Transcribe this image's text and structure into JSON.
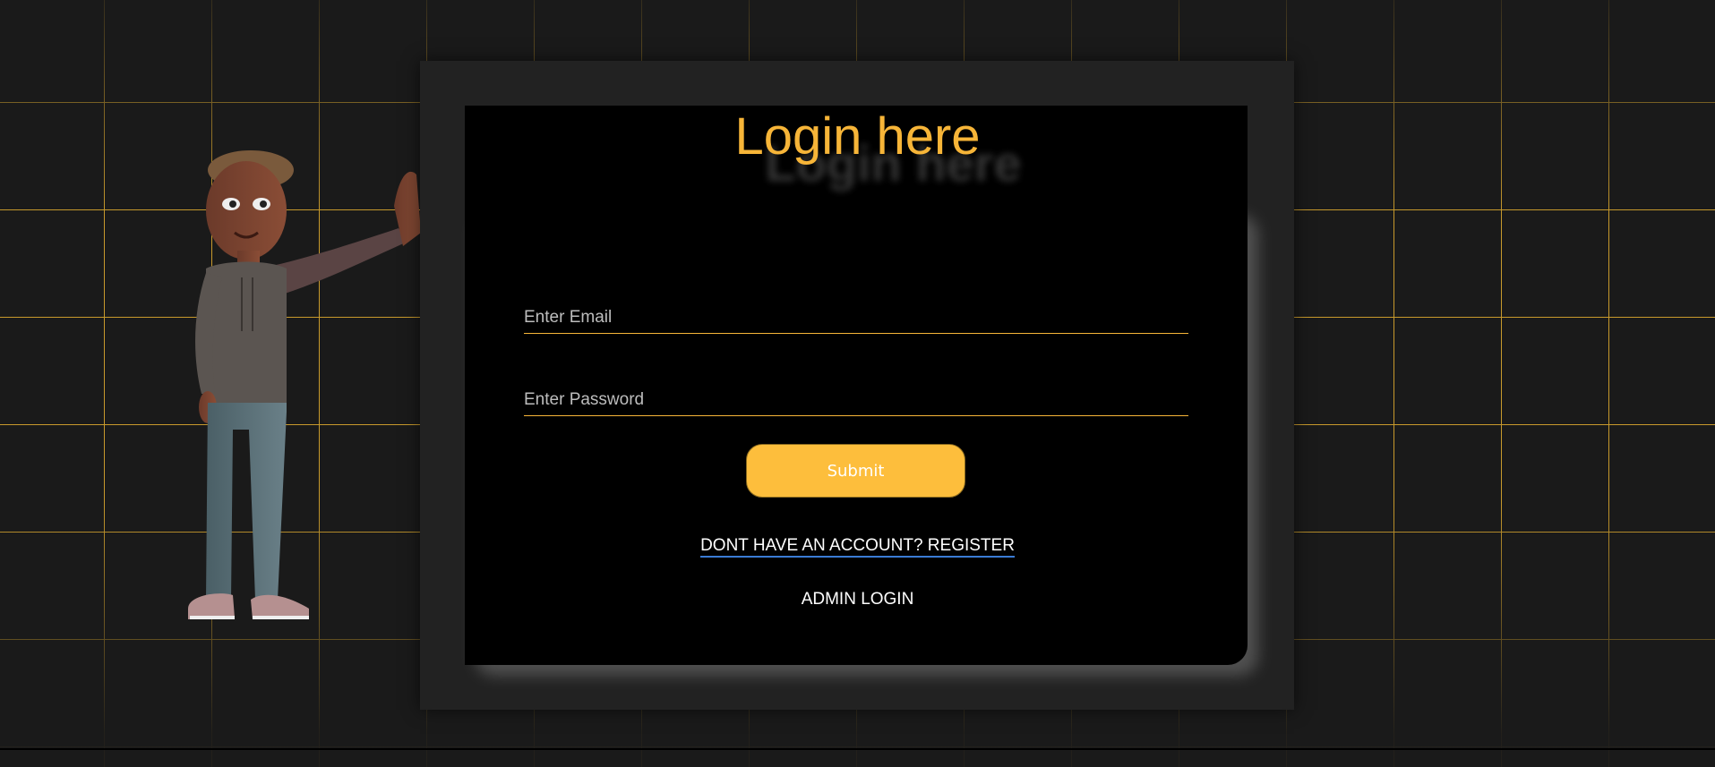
{
  "colors": {
    "accent": "#f7b538",
    "button": "#fdbe3c",
    "background": "#1a1a1a",
    "panel": "#000000",
    "frame": "#222222",
    "link_underline": "#3a7bd5"
  },
  "login": {
    "title": "Login here",
    "email_placeholder": "Enter Email",
    "password_placeholder": "Enter Password",
    "submit_label": "Submit",
    "register_link": "DONT HAVE AN ACCOUNT? REGISTER",
    "admin_link": "ADMIN LOGIN"
  },
  "illustration": {
    "icon": "waving-cartoon-character"
  }
}
